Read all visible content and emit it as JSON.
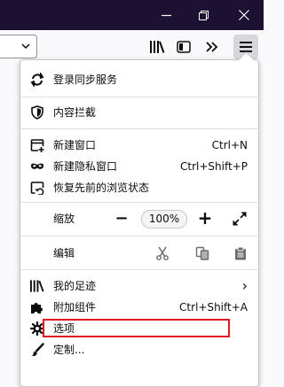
{
  "colors": {
    "titlebar": "#1d1133",
    "highlight": "#e01a1a"
  },
  "titlebar": {
    "icons": [
      "minimize-icon",
      "restore-icon",
      "close-icon"
    ]
  },
  "toolbar": {
    "icons": [
      "library-icon",
      "sidebar-icon",
      "overflow-icon",
      "hamburger-menu-icon"
    ]
  },
  "menu": {
    "sync": "登录同步服务",
    "content_blocking": "内容拦截",
    "new_window": "新建窗口",
    "new_window_shortcut": "Ctrl+N",
    "new_private_window": "新建隐私窗口",
    "new_private_window_shortcut": "Ctrl+Shift+P",
    "restore_session": "恢复先前的浏览状态",
    "zoom_label": "缩放",
    "zoom_minus": "−",
    "zoom_value": "100%",
    "zoom_plus": "+",
    "edit_label": "编辑",
    "library": "我的足迹",
    "library_arrow": "›",
    "addons": "附加组件",
    "addons_shortcut": "Ctrl+Shift+A",
    "options": "选项",
    "customize": "定制..."
  }
}
